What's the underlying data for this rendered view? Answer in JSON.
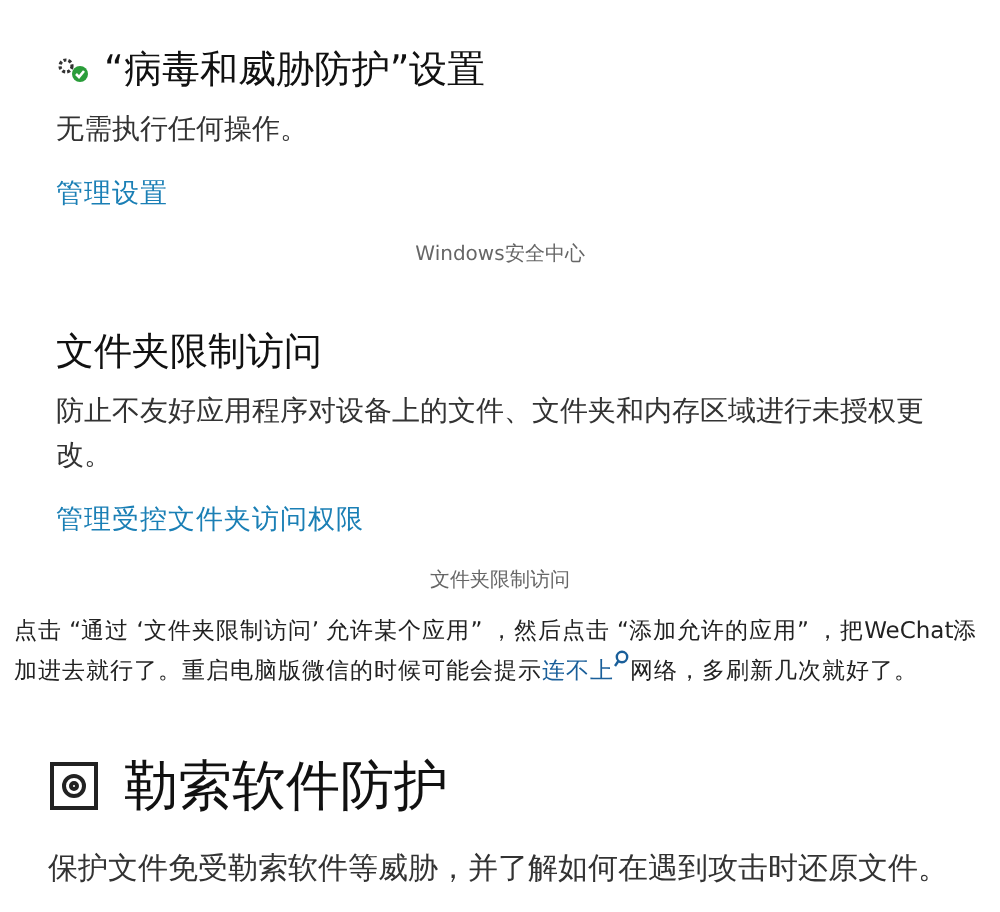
{
  "sections": [
    {
      "kind": "gear",
      "title": "“病毒和威胁防护”设置",
      "description": "无需执行任何操作。",
      "link": "管理设置",
      "caption": "Windows安全中心"
    },
    {
      "kind": "none",
      "title": "文件夹限制访问",
      "description": "防止不友好应用程序对设备上的文件、文件夹和内存区域进行未授权更改。",
      "link": "管理受控文件夹访问权限",
      "caption": "文件夹限制访问"
    }
  ],
  "paragraph": {
    "text_before": "点击 “通过 ‘文件夹限制访问’ 允许某个应用” ，然后点击 “添加允许的应用” ，把WeChat添加进去就行了。重启电脑版微信的时候可能会提示",
    "link": "连不上",
    "text_after": "网络，多刷新几次就好了。"
  },
  "heading": {
    "kind": "safe",
    "title": "勒索软件防护",
    "description": "保护文件免受勒索软件等威胁，并了解如何在遇到攻击时还原文件。"
  }
}
